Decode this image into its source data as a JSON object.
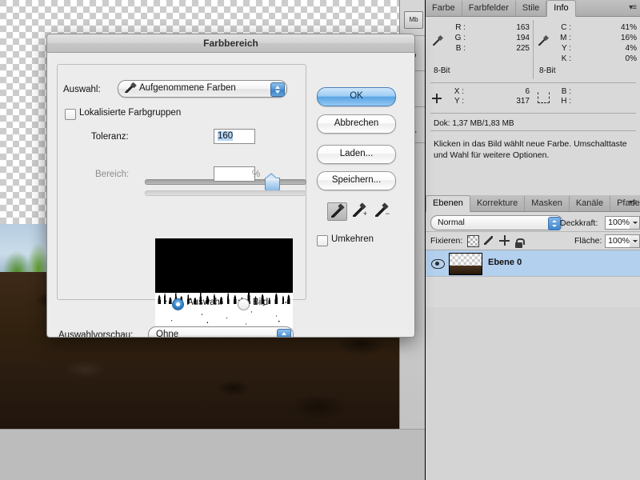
{
  "app": {
    "document_window": {
      "name": "image-canvas",
      "transparency_checker": true
    }
  },
  "dock": {
    "items": [
      {
        "label": "Mb",
        "name": "mini-bridge-icon"
      },
      {
        "label": "↻",
        "name": "history-icon"
      },
      {
        "label": "⊦",
        "name": "actions-icon"
      },
      {
        "label": "◣",
        "name": "tool-presets-icon"
      }
    ]
  },
  "info_panel": {
    "tabs": [
      {
        "label": "Farbe",
        "active": false
      },
      {
        "label": "Farbfelder",
        "active": false
      },
      {
        "label": "Stile",
        "active": false
      },
      {
        "label": "Info",
        "active": true
      }
    ],
    "menu_glyph": "▾≡",
    "rgb": {
      "rows": [
        {
          "label": "R :",
          "value": "163"
        },
        {
          "label": "G :",
          "value": "194"
        },
        {
          "label": "B :",
          "value": "225"
        }
      ],
      "depth": "8-Bit"
    },
    "cmyk": {
      "rows": [
        {
          "label": "C :",
          "value": "41%"
        },
        {
          "label": "M :",
          "value": "16%"
        },
        {
          "label": "Y :",
          "value": "4%"
        },
        {
          "label": "K :",
          "value": "0%"
        }
      ],
      "depth": "8-Bit"
    },
    "coords": {
      "rows": [
        {
          "label": "X :",
          "value": "6"
        },
        {
          "label": "Y :",
          "value": "317"
        }
      ]
    },
    "size": {
      "rows": [
        {
          "label": "B :",
          "value": ""
        },
        {
          "label": "H :",
          "value": ""
        }
      ]
    },
    "doc_size": "Dok: 1,37 MB/1,83 MB",
    "hint": "Klicken in das Bild wählt neue Farbe. Umschalttaste und Wahl für weitere Optionen."
  },
  "layers_panel": {
    "tabs": [
      {
        "label": "Ebenen",
        "active": true
      },
      {
        "label": "Korrekture",
        "active": false
      },
      {
        "label": "Masken",
        "active": false
      },
      {
        "label": "Kanäle",
        "active": false
      },
      {
        "label": "Pfade",
        "active": false
      }
    ],
    "menu_glyph": "▾≡",
    "blend_mode": "Normal",
    "opacity_label": "Deckkraft:",
    "opacity_value": "100%",
    "lock_label": "Fixieren:",
    "lock_icons": [
      "lock-transparency-icon",
      "lock-pixels-icon",
      "lock-position-icon",
      "lock-all-icon"
    ],
    "fill_label": "Fläche:",
    "fill_value": "100%",
    "layers": [
      {
        "name": "Ebene 0",
        "visible": true,
        "selected": true
      }
    ]
  },
  "dialog": {
    "title": "Farbbereich",
    "selection_label": "Auswahl:",
    "selection_value": "Aufgenommene Farben",
    "localized_checkbox_label": "Lokalisierte Farbgruppen",
    "localized_checked": false,
    "tolerance_label": "Toleranz:",
    "tolerance_value": "160",
    "tolerance_slider_percent": 76,
    "range_label": "Bereich:",
    "range_value": "",
    "range_unit": "%",
    "range_slider_percent": 0,
    "preview_mode_selection": "Auswahl",
    "preview_mode_image": "Bild",
    "preview_mode_selected": "Auswahl",
    "invert_label": "Umkehren",
    "invert_checked": false,
    "preview_select_label": "Auswahlvorschau:",
    "preview_select_value": "Ohne",
    "buttons": {
      "ok": "OK",
      "cancel": "Abbrechen",
      "load": "Laden...",
      "save": "Speichern..."
    },
    "eyedroppers": [
      {
        "name": "eyedropper-icon",
        "selected": true
      },
      {
        "name": "eyedropper-add-icon",
        "selected": false,
        "mark": "+"
      },
      {
        "name": "eyedropper-subtract-icon",
        "selected": false,
        "mark": "−"
      }
    ]
  },
  "colors": {
    "accent_blue": "#5aa4e4",
    "layer_selected": "#b3d0ee",
    "panel_bg": "#d9d9d9",
    "dialog_bg": "#ececec",
    "window_bg": "#c8c8c8"
  }
}
